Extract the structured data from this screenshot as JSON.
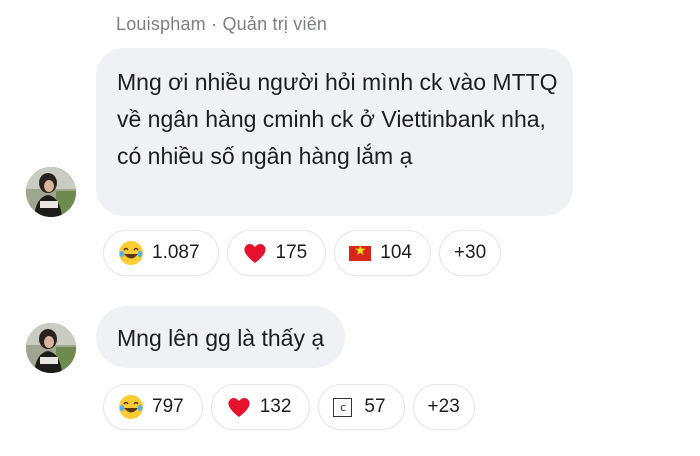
{
  "comment1": {
    "author": "Louispham",
    "separator": " · ",
    "role": "Quản trị viên",
    "text": "Mng ơi nhiều người hỏi mình ck vào MTTQ về ngân hàng cminh ck ở Viettinbank nha, có nhiều số ngân hàng lắm ạ",
    "reactions": [
      {
        "icon": "laughing-emoji-icon",
        "count": "1.087"
      },
      {
        "icon": "red-heart-icon",
        "count": "175"
      },
      {
        "icon": "vietnam-flag-icon",
        "count": "104"
      },
      {
        "more": "+30"
      }
    ]
  },
  "comment2": {
    "text": "Mng lên gg là thấy ạ",
    "reactions": [
      {
        "icon": "laughing-emoji-icon",
        "count": "797"
      },
      {
        "icon": "red-heart-icon",
        "count": "132"
      },
      {
        "icon": "boxed-c-icon",
        "glyph": "c",
        "count": "57"
      },
      {
        "more": "+23"
      }
    ]
  },
  "colors": {
    "bubble": "#f0f1f4",
    "author": "#7d7f84",
    "heart": "#e8112d",
    "flag_red": "#da251d",
    "flag_star": "#ffde00"
  }
}
